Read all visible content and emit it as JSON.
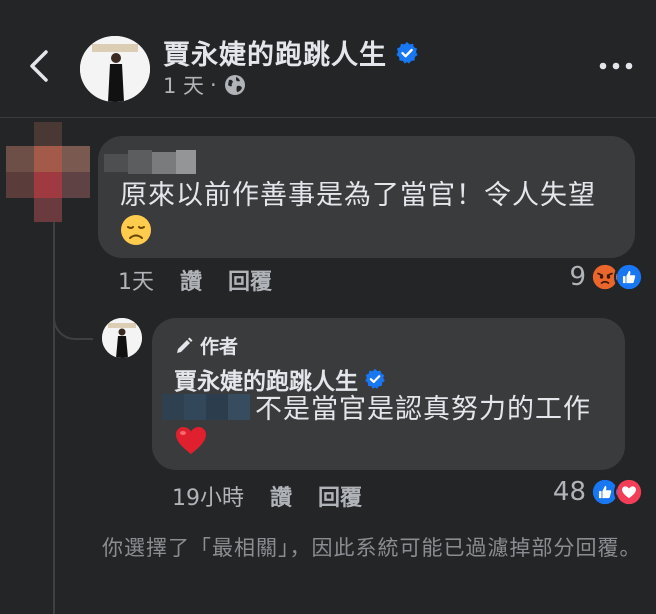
{
  "header": {
    "page_name": "賈永婕的跑跳人生",
    "time": "1 天",
    "separator": "·"
  },
  "comments": [
    {
      "text": "原來以前作善事是為了當官！令人失望",
      "emoji": "disappointed-face",
      "time": "1天",
      "like_label": "讚",
      "reply_label": "回覆",
      "reaction_count": "9",
      "reactions": [
        "angry",
        "like"
      ]
    },
    {
      "author_tag": "作者",
      "author_name": "賈永婕的跑跳人生",
      "text": "不是當官是認真努力的工作",
      "emoji": "red-heart",
      "time": "19小時",
      "like_label": "讚",
      "reply_label": "回覆",
      "reaction_count": "48",
      "reactions": [
        "like",
        "love"
      ]
    }
  ],
  "notice": "你選擇了「最相關」，因此系統可能已過濾掉部分回覆。",
  "colors": {
    "background": "#242526",
    "bubble": "#3a3b3c",
    "verified_blue": "#1877f2",
    "heart_red": "#f33e58",
    "angry_orange": "#e9710f"
  }
}
